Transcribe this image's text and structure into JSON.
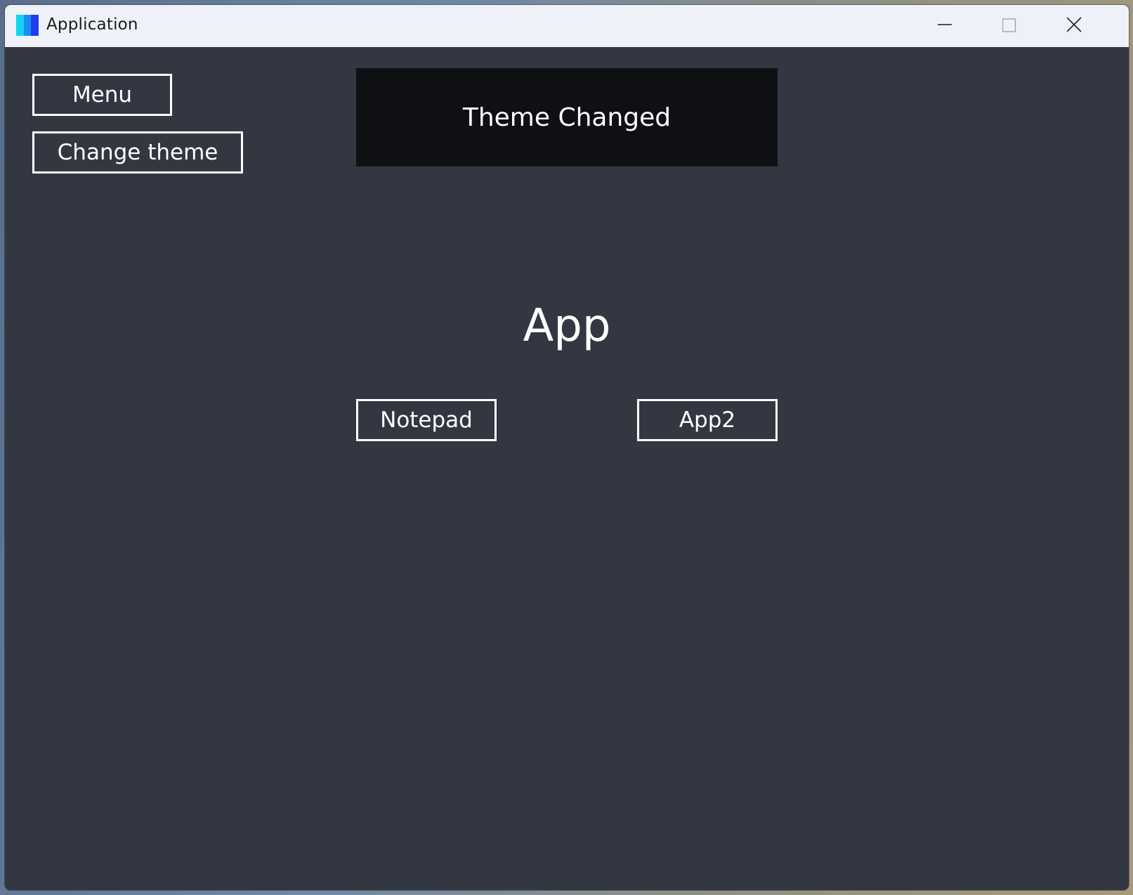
{
  "window": {
    "title": "Application",
    "icon": "app-logo-icon",
    "controls": {
      "minimize_icon": "minimize-icon",
      "maximize_icon": "maximize-icon",
      "close_icon": "close-icon"
    }
  },
  "sidebar": {
    "menu_label": "Menu",
    "change_theme_label": "Change theme"
  },
  "notification": {
    "text": "Theme Changed"
  },
  "main": {
    "heading": "App",
    "apps": [
      {
        "label": "Notepad"
      },
      {
        "label": "App2"
      }
    ]
  },
  "colors": {
    "background": "#333742",
    "notification_background": "#0e1014",
    "foreground": "#ffffff",
    "titlebar": "#eef2f8"
  }
}
